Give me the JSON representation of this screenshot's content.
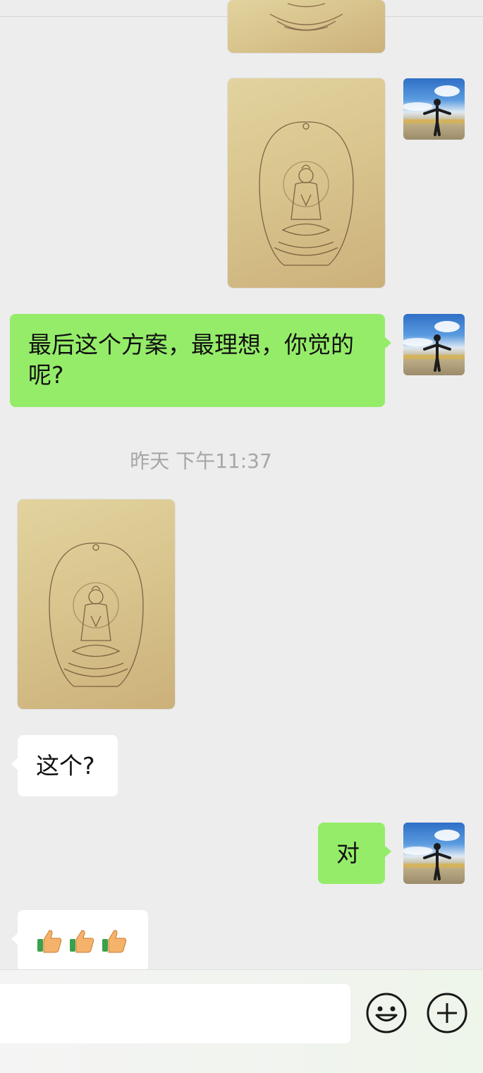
{
  "messages": {
    "sent_text_1": "最后这个方案，最理想，你觉的呢?",
    "timestamp": "昨天 下午11:37",
    "received_text_1": "这个?",
    "sent_text_2": "对",
    "received_emoji": "👍👍👍"
  },
  "images": {
    "top_partial": "buddha-sketch-image",
    "sent_image": "buddha-sketch-image",
    "received_image": "buddha-sketch-image"
  },
  "icons": {
    "emoji_button": "smiley-icon",
    "plus_button": "plus-icon"
  },
  "colors": {
    "background": "#ededed",
    "sent_bubble": "#95ec69",
    "received_bubble": "#ffffff",
    "timestamp_text": "#a6a6a6"
  }
}
